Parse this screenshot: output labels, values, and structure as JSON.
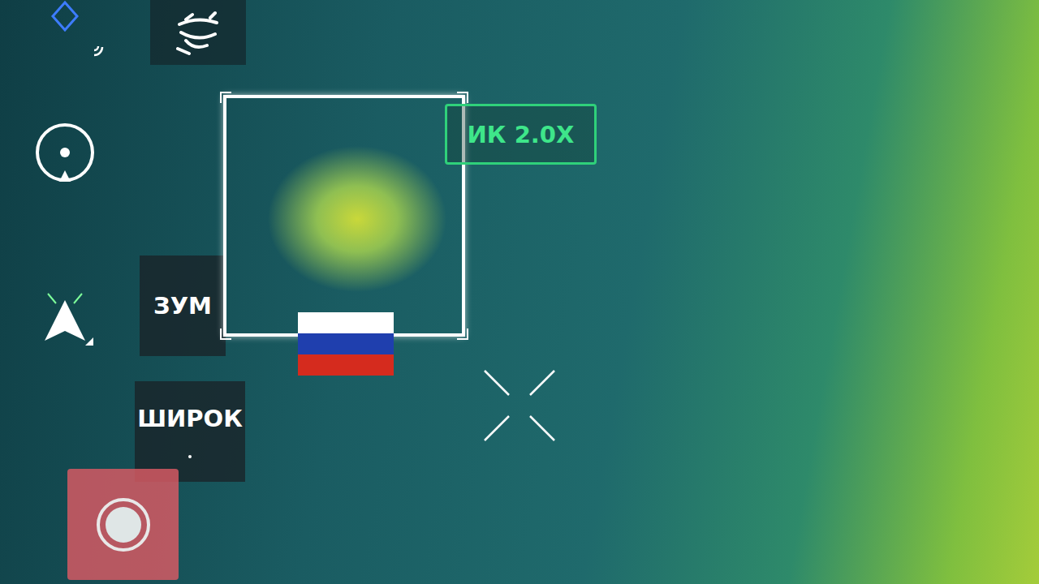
{
  "camera": {
    "mode_badge": "ИК 2.0X",
    "tracking": true
  },
  "side_buttons": [
    {
      "label": "ЗУМ",
      "selected": false
    },
    {
      "label": "ШИРОК",
      "selected": false
    }
  ],
  "flag_stripes": [
    {
      "color": "#ffffff"
    },
    {
      "color": "#1f3fae"
    },
    {
      "color": "#d52b1e"
    }
  ],
  "record": {
    "recording": false
  }
}
